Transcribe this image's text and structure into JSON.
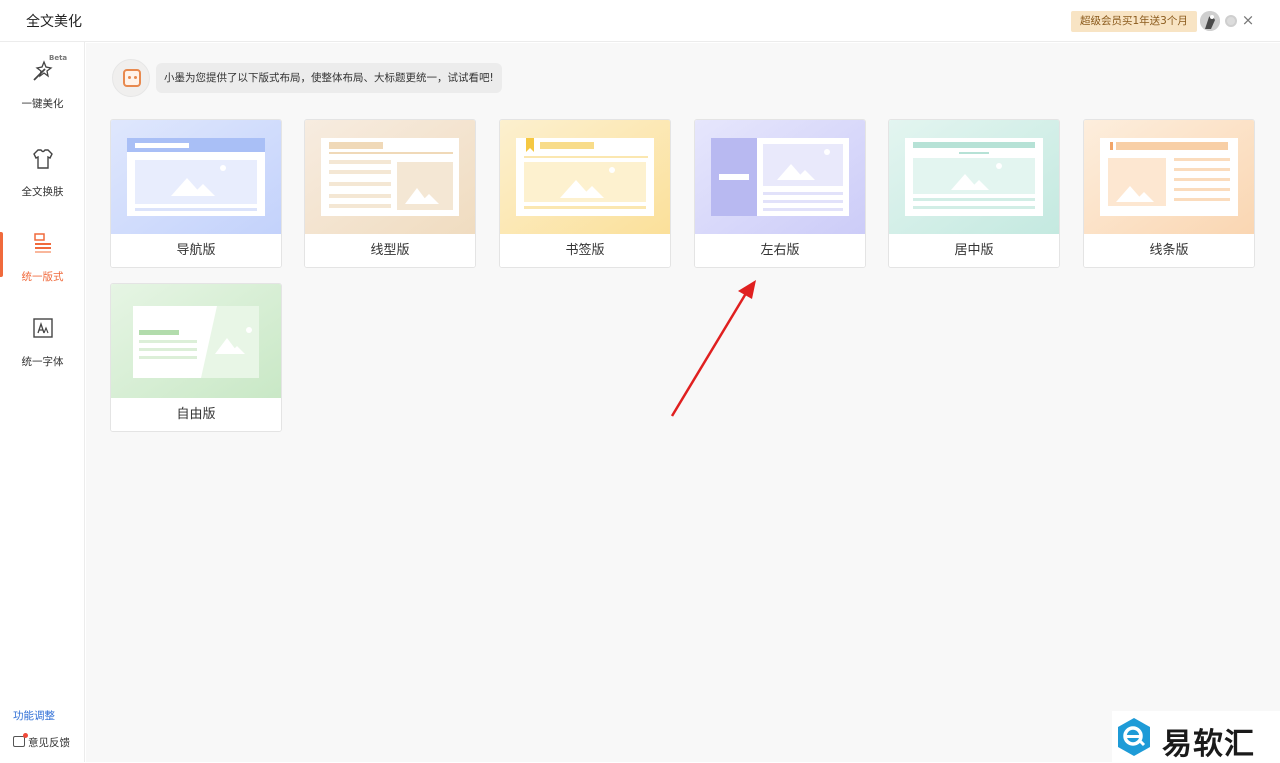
{
  "app": {
    "title": "全文美化"
  },
  "header": {
    "promo": "超级会员买1年送3个月",
    "close": "×"
  },
  "sidebar": {
    "items": [
      {
        "label": "一键美化",
        "badge": "Beta",
        "icon": "magic-wand-icon"
      },
      {
        "label": "全文换肤",
        "icon": "tshirt-icon"
      },
      {
        "label": "统一版式",
        "icon": "layout-icon",
        "active": true
      },
      {
        "label": "统一字体",
        "icon": "font-icon"
      }
    ],
    "footer_link": "功能调整",
    "feedback": "意见反馈"
  },
  "tip": "小墨为您提供了以下版式布局，使整体布局、大标题更统一，试试看吧!",
  "layouts": [
    {
      "label": "导航版",
      "color": "#c8d6fb"
    },
    {
      "label": "线型版",
      "color": "#f2dfc4"
    },
    {
      "label": "书签版",
      "color": "#fbe3a4"
    },
    {
      "label": "左右版",
      "color": "#d6d7fb"
    },
    {
      "label": "居中版",
      "color": "#c9ece4"
    },
    {
      "label": "线条版",
      "color": "#fbdcbd"
    },
    {
      "label": "自由版",
      "color": "#cbe8c8"
    }
  ],
  "watermark": {
    "text": "易软汇"
  },
  "colors": {
    "accent": "#f06a3c",
    "link": "#2f6fd6",
    "arrow": "#e02020"
  }
}
